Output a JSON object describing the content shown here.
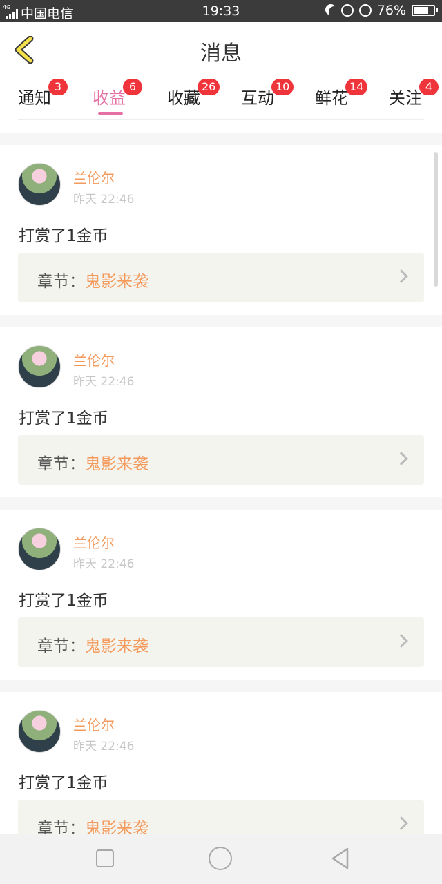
{
  "status": {
    "carrier": "中国电信",
    "time": "19:33",
    "battery": "76%",
    "battery_level": 0.76,
    "network_tag": "4G"
  },
  "header": {
    "title": "消息"
  },
  "tabs": [
    {
      "label": "通知",
      "badge": "3"
    },
    {
      "label": "收益",
      "badge": "6",
      "active": true
    },
    {
      "label": "收藏",
      "badge": "26"
    },
    {
      "label": "互动",
      "badge": "10"
    },
    {
      "label": "鲜花",
      "badge": "14"
    },
    {
      "label": "关注",
      "badge": "4"
    }
  ],
  "messages": [
    {
      "user": "兰伦尔",
      "time": "昨天 22:46",
      "text": "打赏了1金币",
      "chapter_label": "章节：",
      "chapter_title": "鬼影来袭"
    },
    {
      "user": "兰伦尔",
      "time": "昨天 22:46",
      "text": "打赏了1金币",
      "chapter_label": "章节：",
      "chapter_title": "鬼影来袭"
    },
    {
      "user": "兰伦尔",
      "time": "昨天 22:46",
      "text": "打赏了1金币",
      "chapter_label": "章节：",
      "chapter_title": "鬼影来袭"
    },
    {
      "user": "兰伦尔",
      "time": "昨天 22:46",
      "text": "打赏了1金币",
      "chapter_label": "章节：",
      "chapter_title": "鬼影来袭"
    }
  ],
  "colors": {
    "accent": "#e66fa3",
    "badge": "#f0343b",
    "name": "#f39a5c"
  }
}
